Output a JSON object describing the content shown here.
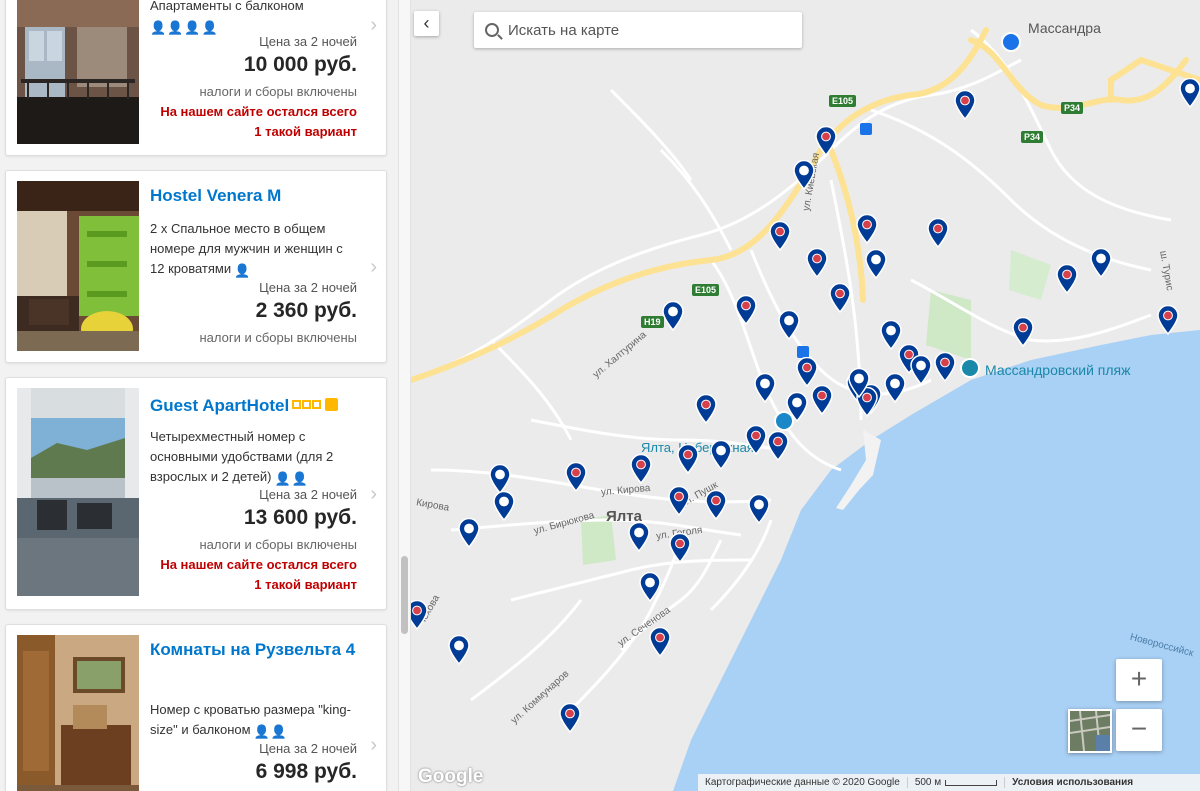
{
  "listings": [
    {
      "title": "",
      "description": "Апартаменты с балконом",
      "price_label": "Цена за 2 ночей",
      "price": "10 000 руб.",
      "taxes": "налоги и сборы включены",
      "warning1": "На нашем сайте остался всего",
      "warning2": "1 такой вариант",
      "guests": 4
    },
    {
      "title": "Hostel Venera M",
      "description": "2 x Спальное место в общем номере для мужчин и женщин с 12 кроватями",
      "price_label": "Цена за 2 ночей",
      "price": "2 360 руб.",
      "taxes": "налоги и сборы включены",
      "guests": 1
    },
    {
      "title": "Guest ApartHotel",
      "stars": 3,
      "description": "Четырехместный номер с основными удобствами (для 2 взрослых и 2 детей)",
      "price_label": "Цена за 2 ночей",
      "price": "13 600 руб.",
      "taxes": "налоги и сборы включены",
      "warning1": "На нашем сайте остался всего",
      "warning2": "1 такой вариант",
      "guests": 2
    },
    {
      "title": "Комнаты на Рузвельта 4",
      "description": "Номер с кроватью размера \"king-size\" и балконом",
      "price_label": "Цена за 2 ночей",
      "price": "6 998 руб.",
      "guests": 2
    }
  ],
  "map": {
    "search_placeholder": "Искать на карте",
    "collapse_icon": "chevron-left-icon",
    "labels": {
      "massandra": "Массандра",
      "beach": "Массандровский пляж",
      "yalta": "Ялта",
      "embankment": "Ялта, Набережная"
    },
    "streets": {
      "kievskaya": "ул. Киевская",
      "khalturina": "ул. Халтурина",
      "kirova": "ул. Кирова",
      "kirova2": "Кирова",
      "biryukova": "ул. Бирюкова",
      "gogolya": "ул. Гоголя",
      "sechenova": "ул. Сеченова",
      "kommunarov": "ул. Коммунаров",
      "turistskaya": "ш. Турис",
      "novorossiysk": "Новороссийск",
      "chekhova": "Чехова",
      "pushkinskaya": "ул. Пушк"
    },
    "road_shields": [
      "E105",
      "E105",
      "H19",
      "P34",
      "P34"
    ],
    "zoom_in": "+",
    "zoom_out": "−",
    "google": "Google",
    "attribution": "Картографические данные © 2020 Google",
    "scale": "500 м",
    "terms": "Условия использования",
    "colors": {
      "water": "#a9d0f5",
      "pin": "#003b95",
      "pin_dot": "#d7414b",
      "road_major": "#fde293"
    }
  }
}
